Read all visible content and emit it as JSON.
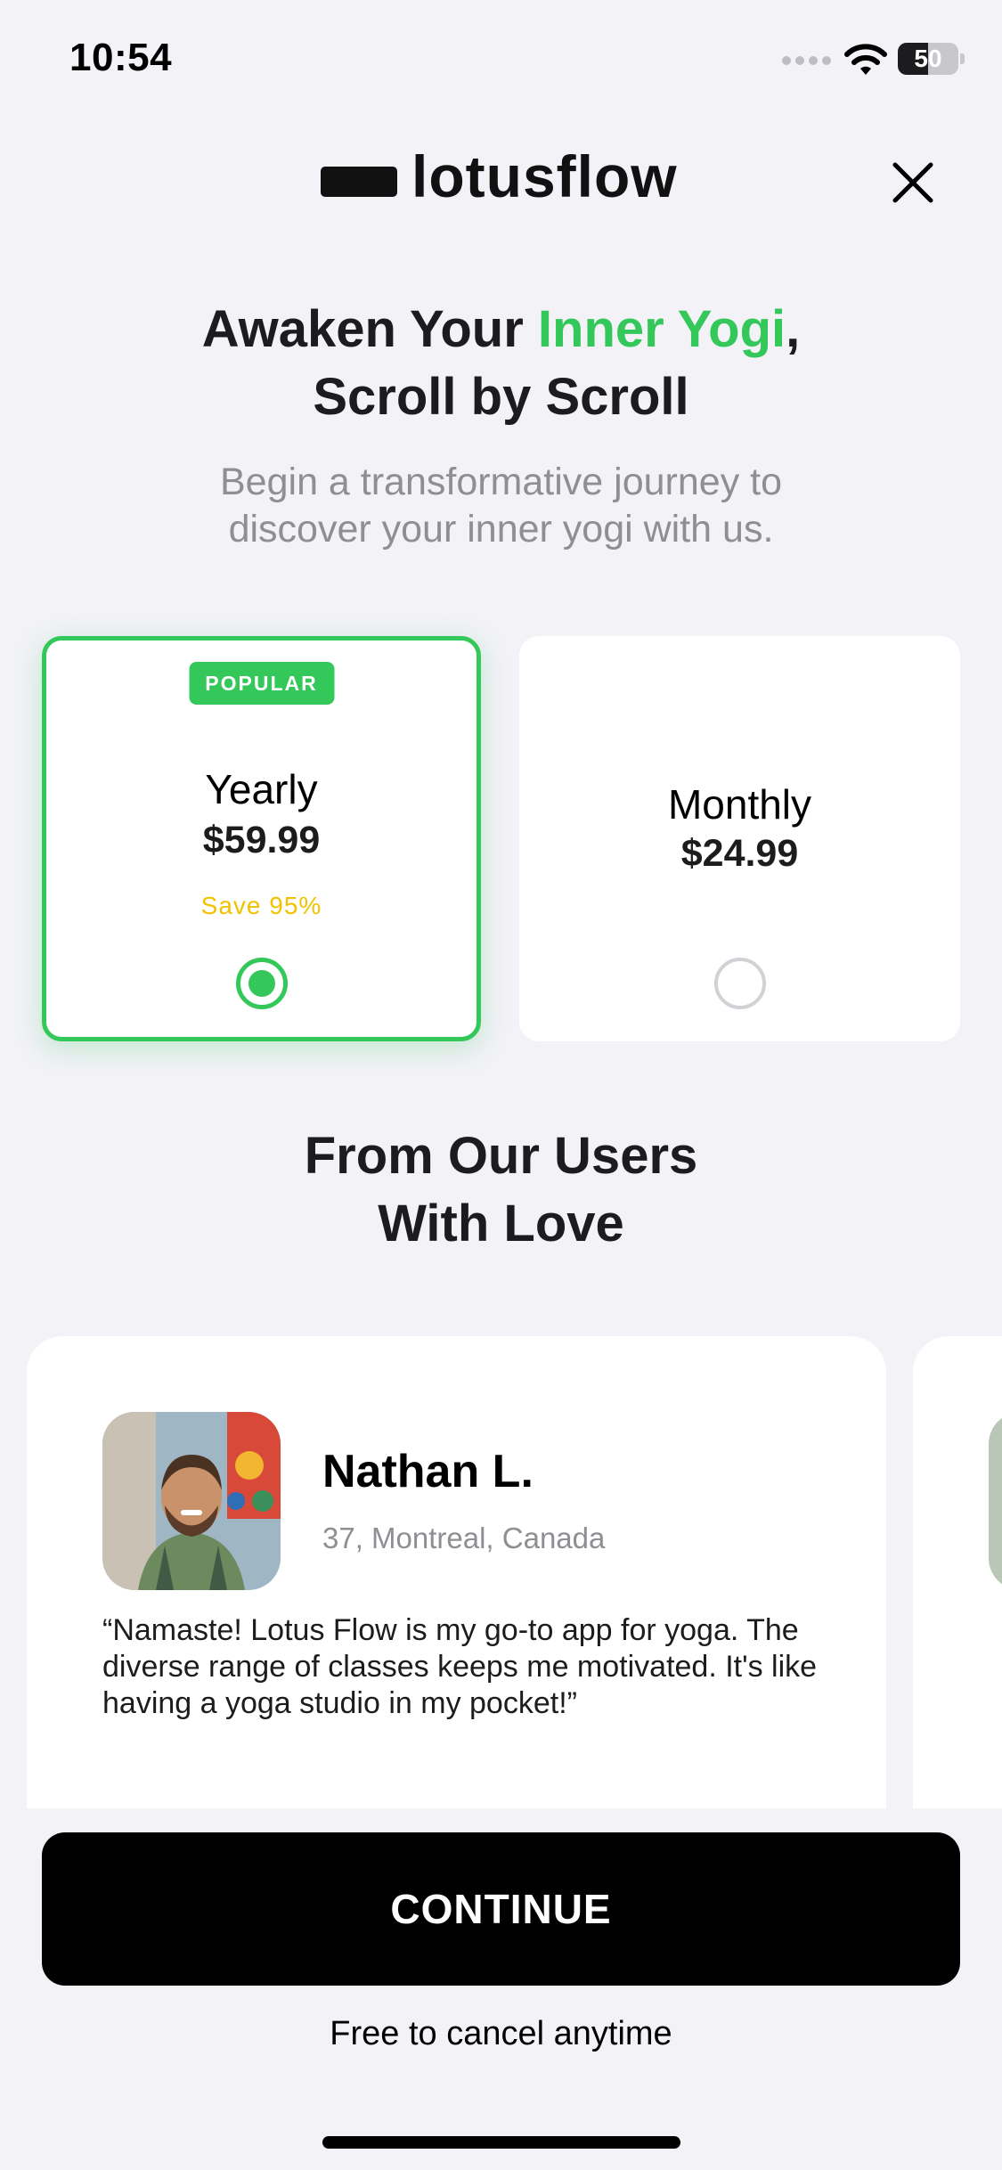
{
  "status_bar": {
    "time": "10:54",
    "battery_text": "50",
    "battery_level": 0.5
  },
  "brand": {
    "name": "lotusflow"
  },
  "close": {
    "icon": "close-icon"
  },
  "headline": {
    "part1": "Awaken Your ",
    "accent": "Inner Yogi",
    "part2": ",",
    "line2": "Scroll by Scroll"
  },
  "subheadline": {
    "line1": "Begin a transformative journey to",
    "line2": "discover your inner yogi with us."
  },
  "plans": [
    {
      "badge": "POPULAR",
      "name": "Yearly",
      "price": "$59.99",
      "note": "Save 95%",
      "selected": true
    },
    {
      "name": "Monthly",
      "price": "$24.99",
      "selected": false
    }
  ],
  "reviews_section": {
    "title_line1": "From Our Users",
    "title_line2": "With Love"
  },
  "reviews": [
    {
      "name": "Nathan L.",
      "meta": "37, Montreal, Canada",
      "text": "“Namaste! Lotus Flow is my go-to app for yoga. The diverse range of classes keeps me motivated. It's like having a yoga studio in my pocket!”"
    }
  ],
  "cta": {
    "label": "CONTINUE",
    "note": "Free to cancel anytime"
  },
  "colors": {
    "accent": "#34c759",
    "save": "#f2c200",
    "background": "#f2f2f7"
  }
}
